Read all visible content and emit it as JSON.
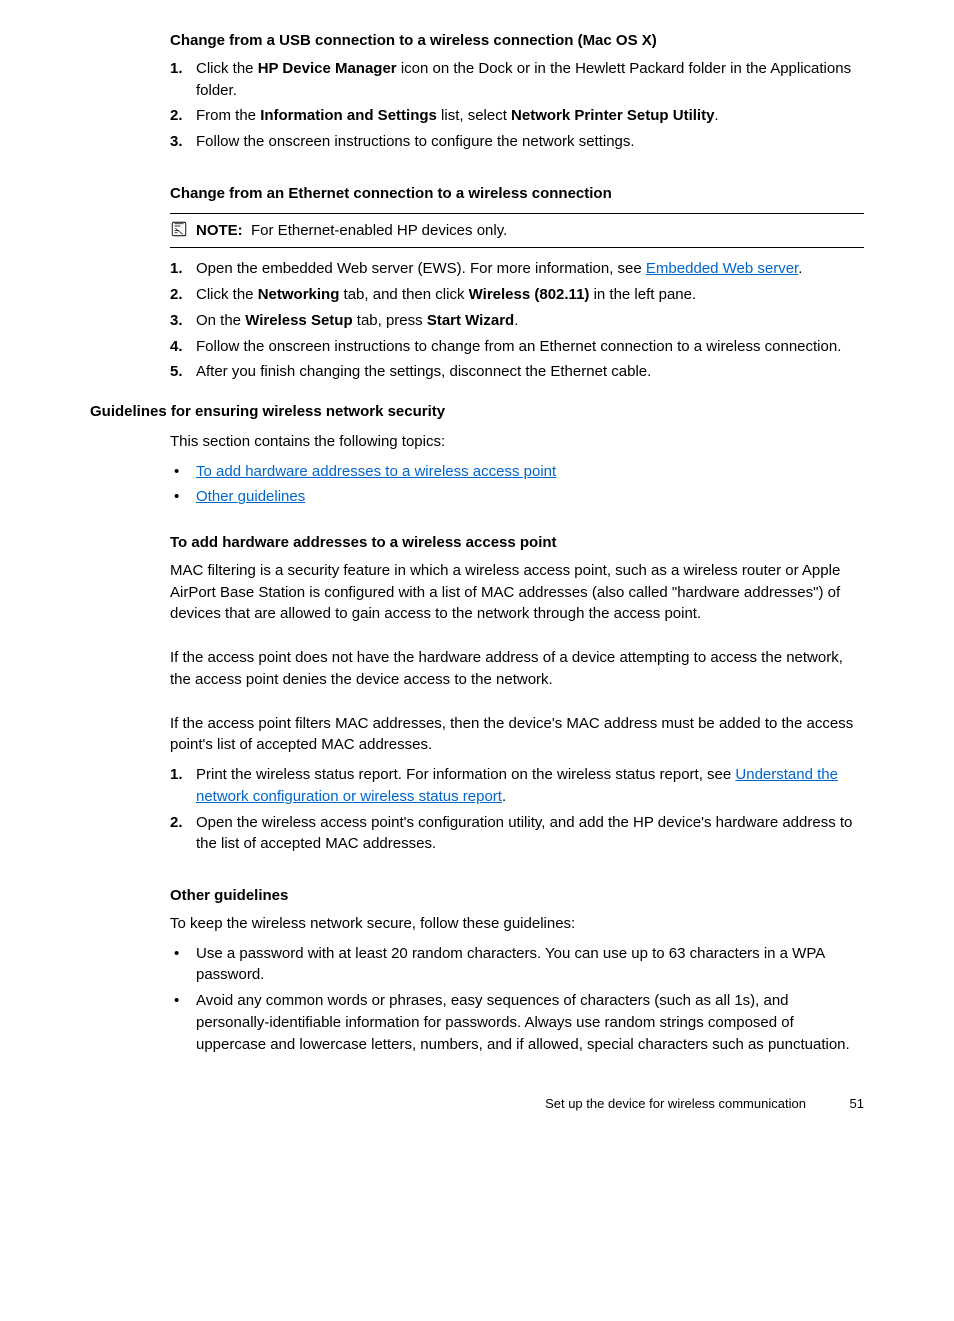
{
  "sec1": {
    "heading": "Change from a USB connection to a wireless connection (Mac OS X)",
    "steps": [
      {
        "pre": "Click the ",
        "b1": "HP Device Manager",
        "post": " icon on the Dock or in the Hewlett Packard folder in the Applications folder."
      },
      {
        "pre": "From the ",
        "b1": "Information and Settings",
        "mid": " list, select ",
        "b2": "Network Printer Setup Utility",
        "post": "."
      },
      {
        "text": "Follow the onscreen instructions to configure the network settings."
      }
    ]
  },
  "sec2": {
    "heading": "Change from an Ethernet connection to a wireless connection",
    "note_label": "NOTE:",
    "note_text": "For Ethernet-enabled HP devices only.",
    "steps": [
      {
        "pre": "Open the embedded Web server (EWS). For more information, see ",
        "link": "Embedded Web server",
        "post": "."
      },
      {
        "pre": "Click the ",
        "b1": "Networking",
        "mid": " tab, and then click ",
        "b2": "Wireless (802.11)",
        "post": " in the left pane."
      },
      {
        "pre": "On the ",
        "b1": "Wireless Setup",
        "mid": " tab, press ",
        "b2": "Start Wizard",
        "post": "."
      },
      {
        "text": "Follow the onscreen instructions to change from an Ethernet connection to a wireless connection."
      },
      {
        "text": "After you finish changing the settings, disconnect the Ethernet cable."
      }
    ]
  },
  "sec3": {
    "heading": "Guidelines for ensuring wireless network security",
    "intro": "This section contains the following topics:",
    "links": [
      "To add hardware addresses to a wireless access point",
      "Other guidelines"
    ]
  },
  "sec4": {
    "heading": "To add hardware addresses to a wireless access point",
    "p1": "MAC filtering is a security feature in which a wireless access point, such as a wireless router or Apple AirPort Base Station is configured with a list of MAC addresses (also called \"hardware addresses\") of devices that are allowed to gain access to the network through the access point.",
    "p2": "If the access point does not have the hardware address of a device attempting to access the network, the access point denies the device access to the network.",
    "p3": "If the access point filters MAC addresses, then the device's MAC address must be added to the access point's list of accepted MAC addresses.",
    "steps": [
      {
        "pre": "Print the wireless status report. For information on the wireless status report, see ",
        "link": "Understand the network configuration or wireless status report",
        "post": "."
      },
      {
        "text": "Open the wireless access point's configuration utility, and add the HP device's hardware address to the list of accepted MAC addresses."
      }
    ]
  },
  "sec5": {
    "heading": "Other guidelines",
    "intro": "To keep the wireless network secure, follow these guidelines:",
    "bullets": [
      "Use a password with at least 20 random characters. You can use up to 63 characters in a WPA password.",
      "Avoid any common words or phrases, easy sequences of characters (such as all 1s), and personally-identifiable information for passwords. Always use random strings composed of uppercase and lowercase letters, numbers, and if allowed, special characters such as punctuation."
    ]
  },
  "footer": {
    "label": "Set up the device for wireless communication",
    "page": "51"
  }
}
